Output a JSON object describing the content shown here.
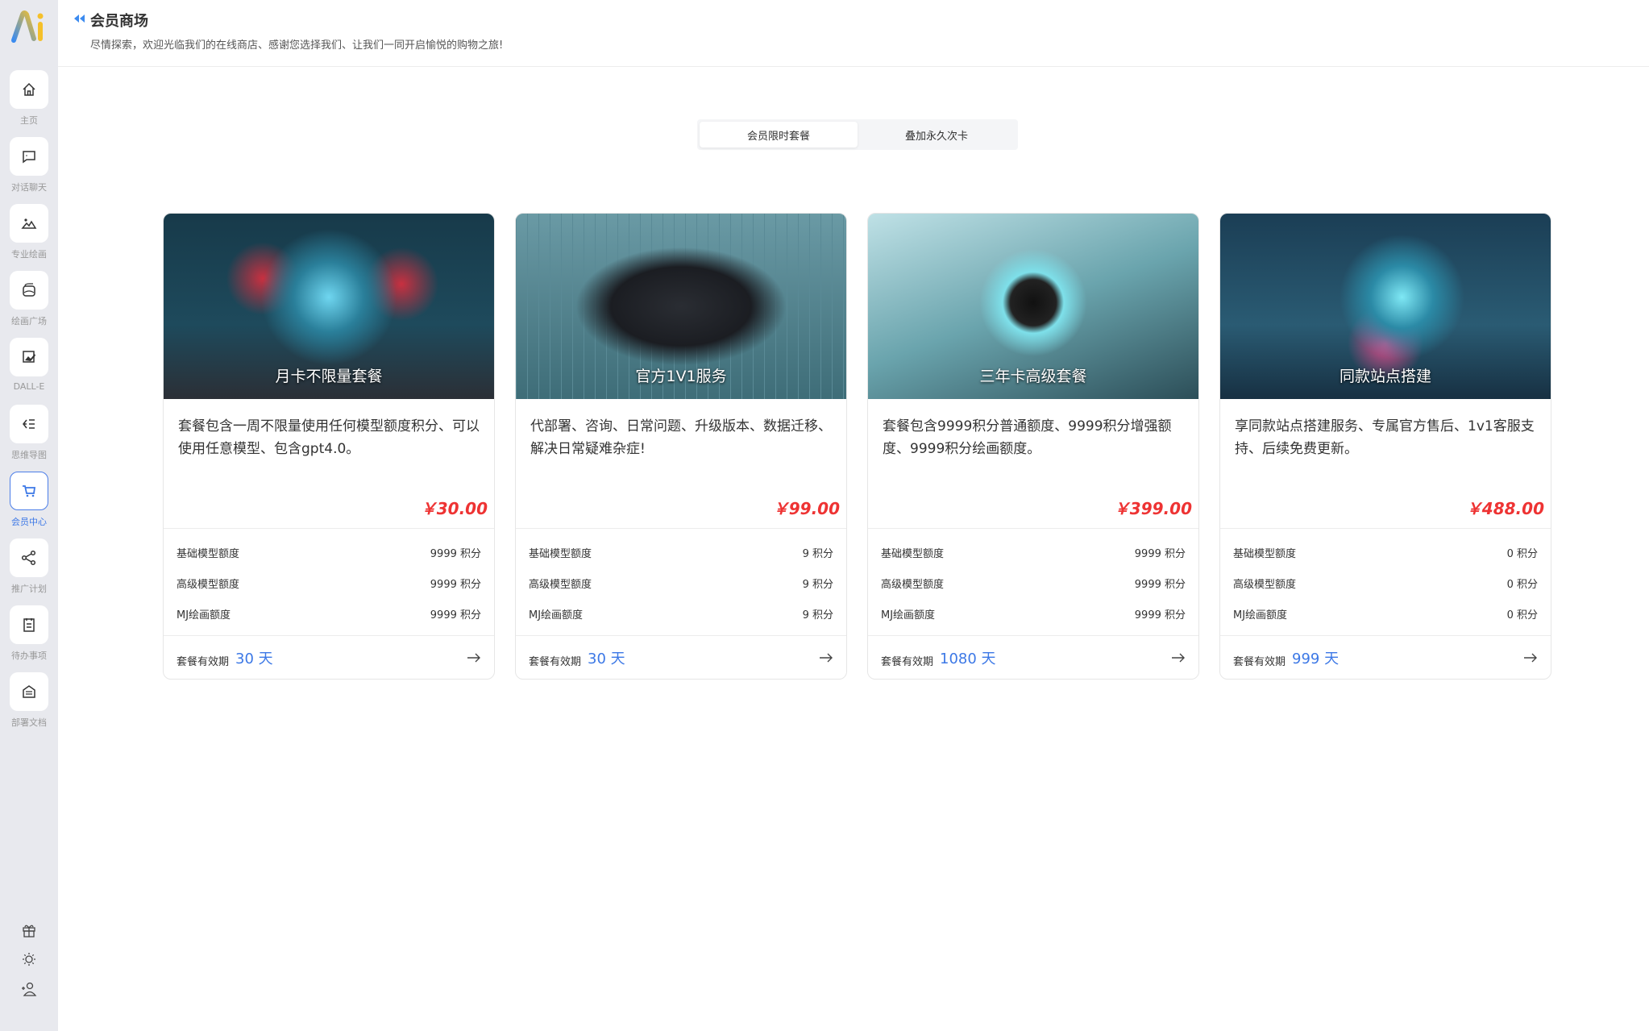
{
  "header": {
    "title": "会员商场",
    "subtitle": "尽情探索，欢迎光临我们的在线商店、感谢您选择我们、让我们一同开启愉悦的购物之旅!"
  },
  "sidebar": {
    "items": [
      {
        "label": "主页",
        "icon": "home-icon"
      },
      {
        "label": "对话聊天",
        "icon": "chat-icon"
      },
      {
        "label": "专业绘画",
        "icon": "image-icon"
      },
      {
        "label": "绘画广场",
        "icon": "gallery-icon"
      },
      {
        "label": "DALL-E",
        "icon": "image-edit-icon"
      },
      {
        "label": "思维导图",
        "icon": "mindmap-icon"
      },
      {
        "label": "会员中心",
        "icon": "cart-icon",
        "active": true
      },
      {
        "label": "推广计划",
        "icon": "share-icon"
      },
      {
        "label": "待办事项",
        "icon": "clipboard-icon"
      },
      {
        "label": "部署文档",
        "icon": "document-icon"
      }
    ],
    "bottom": [
      "gift-icon",
      "sun-icon",
      "user-add-icon"
    ]
  },
  "tabs": [
    {
      "label": "会员限时套餐",
      "active": true
    },
    {
      "label": "叠加永久次卡"
    }
  ],
  "accent": "#3c78e6",
  "price_color": "#e33333",
  "cards": [
    {
      "caption": "月卡不限量套餐",
      "desc": "套餐包含一周不限量使用任何模型额度积分、可以使用任意模型、包含gpt4.0。",
      "price": "￥30.00",
      "rows": [
        {
          "k": "基础模型额度",
          "v": "9999 积分"
        },
        {
          "k": "高级模型额度",
          "v": "9999 积分"
        },
        {
          "k": "MJ绘画额度",
          "v": "9999 积分"
        }
      ],
      "valid_label": "套餐有效期",
      "valid": "30 天"
    },
    {
      "caption": "官方1V1服务",
      "desc": "代部署、咨询、日常问题、升级版本、数据迁移、解决日常疑难杂症!",
      "price": "￥99.00",
      "rows": [
        {
          "k": "基础模型额度",
          "v": "9 积分"
        },
        {
          "k": "高级模型额度",
          "v": "9 积分"
        },
        {
          "k": "MJ绘画额度",
          "v": "9 积分"
        }
      ],
      "valid_label": "套餐有效期",
      "valid": "30 天"
    },
    {
      "caption": "三年卡高级套餐",
      "desc": "套餐包含9999积分普通额度、9999积分增强额度、9999积分绘画额度。",
      "price": "￥399.00",
      "rows": [
        {
          "k": "基础模型额度",
          "v": "9999 积分"
        },
        {
          "k": "高级模型额度",
          "v": "9999 积分"
        },
        {
          "k": "MJ绘画额度",
          "v": "9999 积分"
        }
      ],
      "valid_label": "套餐有效期",
      "valid": "1080 天"
    },
    {
      "caption": "同款站点搭建",
      "desc": "享同款站点搭建服务、专属官方售后、1v1客服支持、后续免费更新。",
      "price": "￥488.00",
      "rows": [
        {
          "k": "基础模型额度",
          "v": "0 积分"
        },
        {
          "k": "高级模型额度",
          "v": "0 积分"
        },
        {
          "k": "MJ绘画额度",
          "v": "0 积分"
        }
      ],
      "valid_label": "套餐有效期",
      "valid": "999 天"
    }
  ]
}
